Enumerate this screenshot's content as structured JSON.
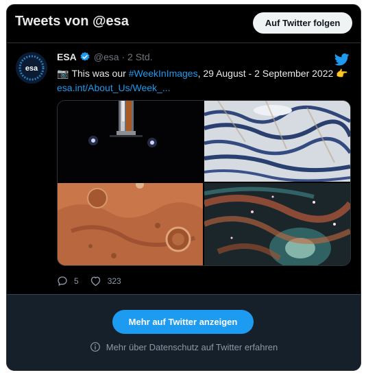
{
  "header": {
    "title": "Tweets von @esa",
    "follow_label": "Auf Twitter folgen"
  },
  "tweet": {
    "author_name": "ESA",
    "handle_time": "@esa · 2 Std.",
    "camera_emoji": "📷",
    "text_before": "This was our ",
    "hashtag": "#WeekInImages",
    "text_after": ", 29 August - 2 September 2022",
    "pointing_emoji": "👉",
    "link": "esa.int/About_Us/Week_...",
    "avatar_text": "esa",
    "replies": "5",
    "likes": "323",
    "images": [
      "rocket-launch-pad-night",
      "snowy-mountain-ridges",
      "mars-crater-surface",
      "galaxy-spiral-infrared"
    ]
  },
  "footer": {
    "more_label": "Mehr auf Twitter anzeigen",
    "privacy_label": "Mehr über Datenschutz auf Twitter erfahren"
  },
  "colors": {
    "accent": "#1d9bf0",
    "background": "#000000",
    "footer_bg": "#15202b"
  },
  "icons": [
    "verified-badge-icon",
    "twitter-bird-icon",
    "reply-icon",
    "heart-icon",
    "info-icon"
  ]
}
